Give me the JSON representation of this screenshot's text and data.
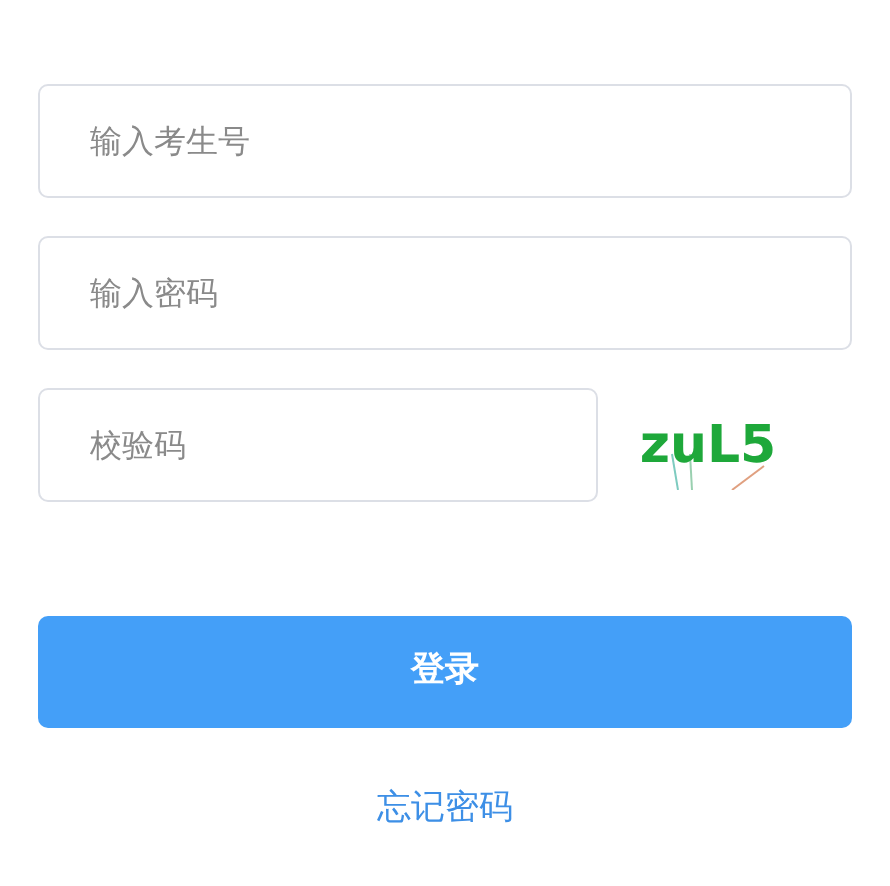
{
  "username": {
    "placeholder": "输入考生号"
  },
  "password": {
    "placeholder": "输入密码"
  },
  "captcha": {
    "placeholder": "校验码",
    "code": "zuL5"
  },
  "login_button": "登录",
  "forgot_link": "忘记密码"
}
